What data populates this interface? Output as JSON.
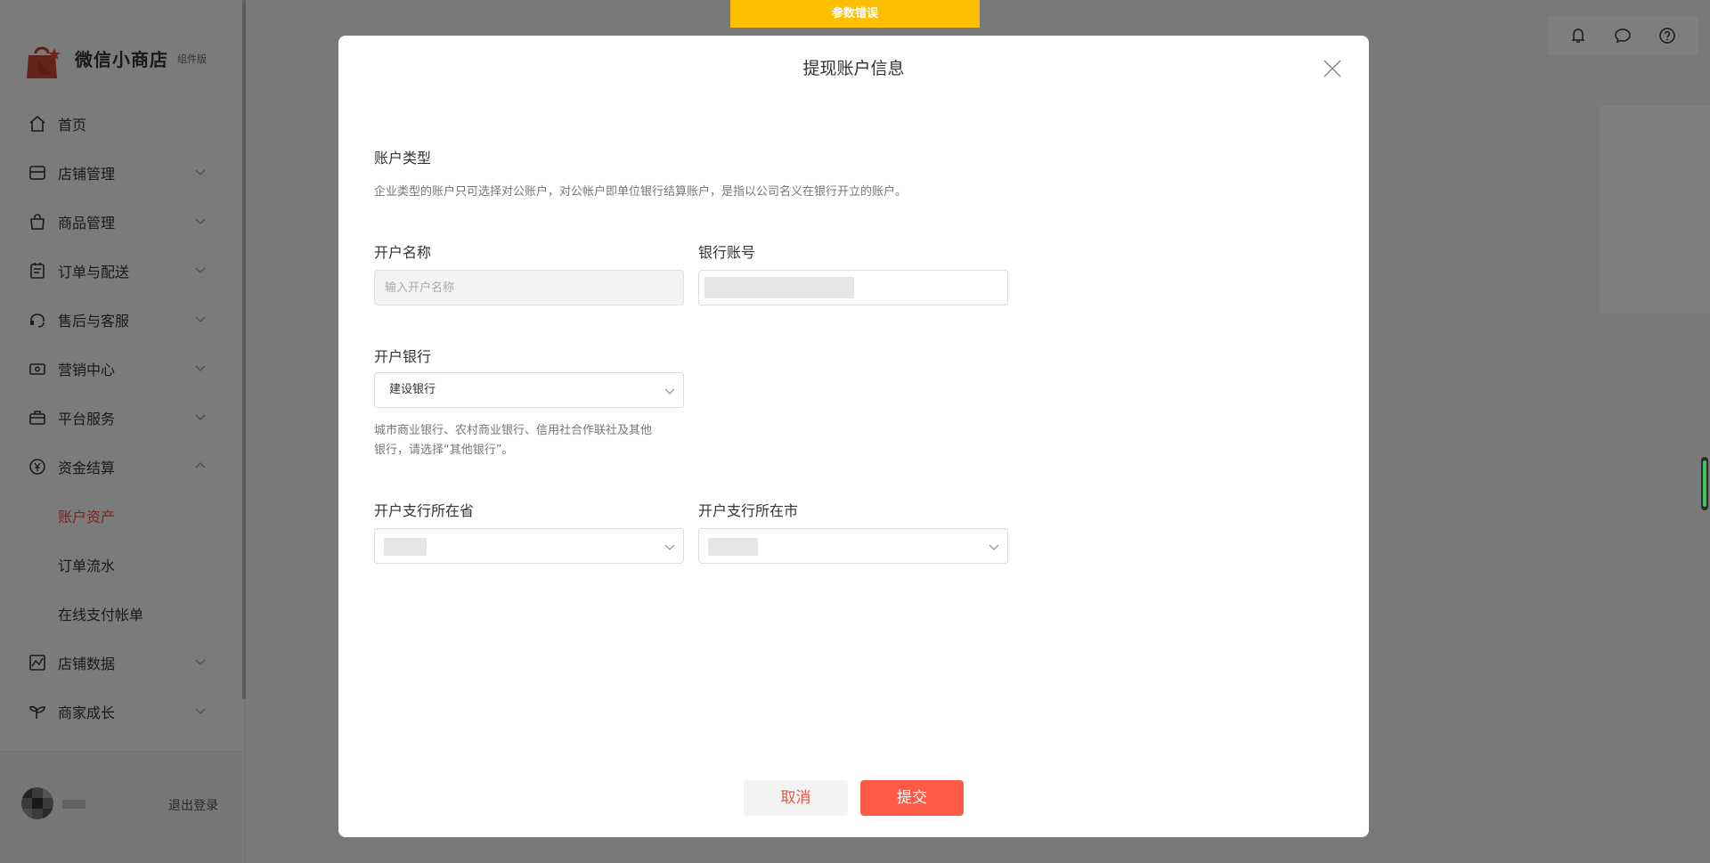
{
  "toast": {
    "text": "参数错误"
  },
  "brand": {
    "name": "微信小商店",
    "sub": "组件版"
  },
  "sidebar": {
    "items": [
      {
        "label": "首页",
        "icon": "home-icon"
      },
      {
        "label": "店铺管理",
        "icon": "store-icon"
      },
      {
        "label": "商品管理",
        "icon": "bag-icon"
      },
      {
        "label": "订单与配送",
        "icon": "order-icon"
      },
      {
        "label": "售后与客服",
        "icon": "headset-icon"
      },
      {
        "label": "营销中心",
        "icon": "ticket-icon"
      },
      {
        "label": "平台服务",
        "icon": "briefcase-icon"
      },
      {
        "label": "资金结算",
        "icon": "yuan-icon"
      }
    ],
    "sub_items": [
      {
        "label": "账户资产",
        "active": true
      },
      {
        "label": "订单流水",
        "active": false
      },
      {
        "label": "在线支付帐单",
        "active": false
      }
    ],
    "items_after": [
      {
        "label": "店铺数据",
        "icon": "chart-icon"
      },
      {
        "label": "商家成长",
        "icon": "sprout-icon"
      }
    ],
    "logout": "退出登录"
  },
  "modal": {
    "title": "提现账户信息",
    "account_type_label": "账户类型",
    "account_type_hint": "企业类型的账户只可选择对公账户，对公帐户即单位银行结算账户，是指以公司名义在银行开立的账户。",
    "account_name_label": "开户名称",
    "account_name_placeholder": "输入开户名称",
    "bank_account_label": "银行账号",
    "bank_label": "开户银行",
    "bank_value": "建设银行",
    "bank_hint_line1": "城市商业银行、农村商业银行、信用社合作联社及其他",
    "bank_hint_line2": "银行，请选择“其他银行”。",
    "province_label": "开户支行所在省",
    "city_label": "开户支行所在市",
    "cancel": "取消",
    "submit": "提交"
  },
  "colors": {
    "accent": "#e7533f",
    "submit": "#ff5a45",
    "toast": "#fcc000"
  }
}
